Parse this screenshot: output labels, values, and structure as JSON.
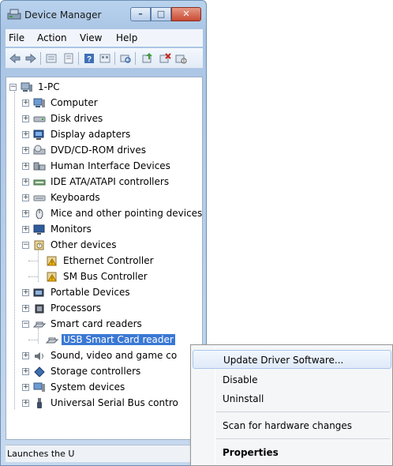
{
  "window": {
    "title": "Device Manager",
    "buttons": {
      "minimize": "–",
      "maximize": "□",
      "close": "✕"
    }
  },
  "menubar": [
    "File",
    "Action",
    "View",
    "Help"
  ],
  "toolbar": {
    "icons": [
      "back-arrow-icon",
      "forward-arrow-icon",
      "view-icon",
      "properties-icon",
      "help-icon",
      "view2-icon",
      "scan-icon",
      "update-driver-icon",
      "uninstall-icon",
      "disable-icon"
    ]
  },
  "tree": {
    "root": "1-PC",
    "nodes": [
      {
        "label": "Computer",
        "icon": "computer-icon",
        "expanded": false,
        "level": 1
      },
      {
        "label": "Disk drives",
        "icon": "disk-drive-icon",
        "expanded": false,
        "level": 1
      },
      {
        "label": "Display adapters",
        "icon": "display-adapter-icon",
        "expanded": false,
        "level": 1
      },
      {
        "label": "DVD/CD-ROM drives",
        "icon": "dvd-drive-icon",
        "expanded": false,
        "level": 1
      },
      {
        "label": "Human Interface Devices",
        "icon": "hid-icon",
        "expanded": false,
        "level": 1
      },
      {
        "label": "IDE ATA/ATAPI controllers",
        "icon": "ide-controller-icon",
        "expanded": false,
        "level": 1
      },
      {
        "label": "Keyboards",
        "icon": "keyboard-icon",
        "expanded": false,
        "level": 1
      },
      {
        "label": "Mice and other pointing devices",
        "icon": "mouse-icon",
        "expanded": false,
        "level": 1
      },
      {
        "label": "Monitors",
        "icon": "monitor-icon",
        "expanded": false,
        "level": 1
      },
      {
        "label": "Other devices",
        "icon": "other-devices-icon",
        "expanded": true,
        "level": 1
      },
      {
        "label": "Ethernet Controller",
        "icon": "warning-device-icon",
        "level": 2
      },
      {
        "label": "SM Bus Controller",
        "icon": "warning-device-icon",
        "level": 2
      },
      {
        "label": "Portable Devices",
        "icon": "portable-device-icon",
        "expanded": false,
        "level": 1
      },
      {
        "label": "Processors",
        "icon": "processor-icon",
        "expanded": false,
        "level": 1
      },
      {
        "label": "Smart card readers",
        "icon": "smart-card-reader-icon",
        "expanded": true,
        "level": 1
      },
      {
        "label": "USB Smart Card reader",
        "icon": "smart-card-reader-icon",
        "level": 2,
        "selected": true
      },
      {
        "label": "Sound, video and game co",
        "icon": "sound-icon",
        "expanded": false,
        "level": 1
      },
      {
        "label": "Storage controllers",
        "icon": "storage-controller-icon",
        "expanded": false,
        "level": 1
      },
      {
        "label": "System devices",
        "icon": "system-device-icon",
        "expanded": false,
        "level": 1
      },
      {
        "label": "Universal Serial Bus contro",
        "icon": "usb-icon",
        "expanded": false,
        "level": 1
      }
    ]
  },
  "statusbar": {
    "text": "Launches the U"
  },
  "context_menu": {
    "items": [
      {
        "label": "Update Driver Software...",
        "highlighted": true
      },
      {
        "label": "Disable"
      },
      {
        "label": "Uninstall"
      },
      {
        "separator": true
      },
      {
        "label": "Scan for hardware changes"
      },
      {
        "separator": true
      },
      {
        "label": "Properties",
        "bold": true
      }
    ]
  },
  "colors": {
    "selection": "#3a78d4",
    "close_button": "#c94a33",
    "window_frame": "#b9d3ee"
  }
}
